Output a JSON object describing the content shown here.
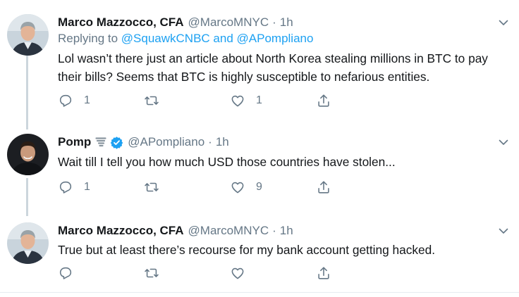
{
  "tweets": [
    {
      "name": "Marco Mazzocco, CFA",
      "handle": "@MarcoMNYC",
      "separator": "·",
      "time": "1h",
      "replying_prefix": "Replying to",
      "replying_to": "@SquawkCNBC and @APompliano",
      "text": "Lol wasn’t there just an article about North Korea stealing millions in BTC to pay their bills? Seems that BTC is highly susceptible to nefarious entities.",
      "reply_count": "1",
      "retweet_count": "",
      "like_count": "1"
    },
    {
      "name": "Pomp",
      "handle": "@APompliano",
      "separator": "·",
      "time": "1h",
      "badge": "verified",
      "name_emoji": "tornado",
      "text": "Wait till I tell you how much USD those countries have stolen...",
      "reply_count": "1",
      "retweet_count": "",
      "like_count": "9"
    },
    {
      "name": "Marco Mazzocco, CFA",
      "handle": "@MarcoMNYC",
      "separator": "·",
      "time": "1h",
      "text": "True but at least there’s recourse for my bank account getting hacked.",
      "reply_count": "",
      "retweet_count": "",
      "like_count": ""
    }
  ],
  "icons": [
    "reply-icon",
    "retweet-icon",
    "like-icon",
    "share-icon",
    "chevron-down-icon",
    "verified-badge-icon",
    "tornado-emoji-icon"
  ],
  "colors": {
    "link": "#1da1f2",
    "text": "#14171a",
    "secondary": "#657786",
    "thread_line": "#ccd6dd",
    "divider": "#e6ecf0"
  }
}
